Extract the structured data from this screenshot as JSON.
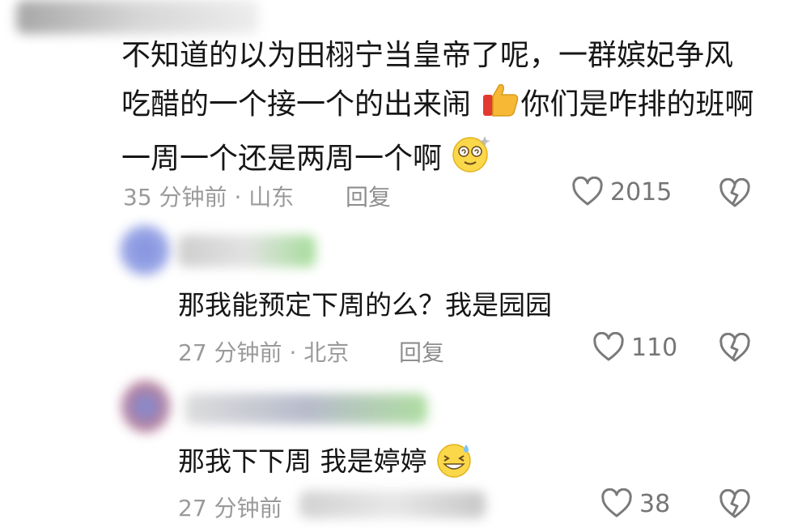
{
  "comments": [
    {
      "text_parts": [
        "不知道的以为田栩宁当皇帝了呢，一群嫔妃争风吃醋的一个接一个的出来闹",
        "你们是咋排的班啊一周一个还是两周一个啊"
      ],
      "emojis": [
        "thumbs-up-emoji",
        "dizzy-face-emoji"
      ],
      "time": "35 分钟前",
      "location": "· 山东",
      "reply_label": "回复",
      "likes": "2015"
    }
  ],
  "replies": [
    {
      "text": "那我能预定下周的么？我是园园",
      "time": "27 分钟前",
      "location": "· 北京",
      "reply_label": "回复",
      "likes": "110"
    },
    {
      "text": "那我下下周 我是婷婷",
      "emoji": "grin-sweat-emoji",
      "time": "27 分钟前",
      "likes": "38"
    }
  ],
  "icons": {
    "like": "heart-outline-icon",
    "dislike": "broken-heart-icon"
  }
}
